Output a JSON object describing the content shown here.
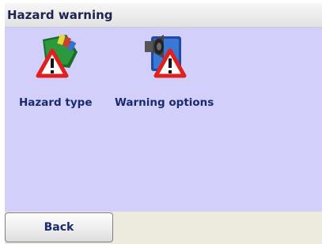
{
  "window": {
    "title": "Hazard warning"
  },
  "tiles": [
    {
      "label": "Hazard type",
      "icon": "warning-folder-icon"
    },
    {
      "label": "Warning options",
      "icon": "warning-speaker-icon"
    }
  ],
  "footer": {
    "back_label": "Back"
  },
  "colors": {
    "background": "#d2d0fa",
    "title_text": "#1f2350",
    "label_text": "#1b2a6d",
    "footer": "#ecebdd",
    "warning_red": "#e0201c"
  }
}
